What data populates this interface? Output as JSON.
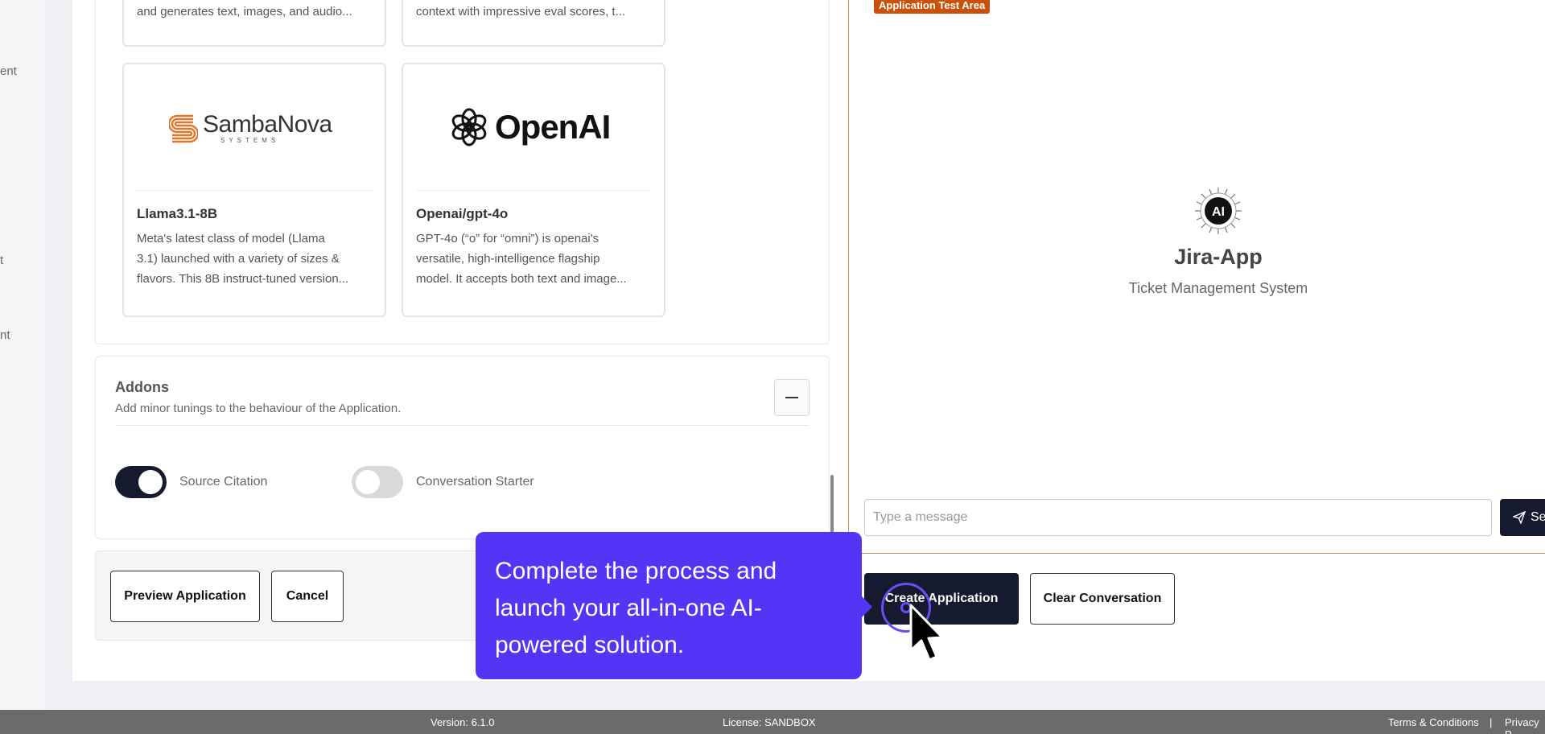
{
  "left_nav": {
    "fragments": [
      "ent",
      "t",
      "nt"
    ]
  },
  "models": {
    "top_cards": [
      {
        "desc": "and generates text, images, and audio..."
      },
      {
        "desc": "context with impressive eval scores, t..."
      }
    ],
    "cards": [
      {
        "brand_main": "SambaNova",
        "brand_sub": "SYSTEMS",
        "name": "Llama3.1-8B",
        "desc": [
          "Meta's latest class of model (Llama",
          "3.1) launched with a variety of sizes &",
          "flavors. This 8B instruct-tuned version..."
        ]
      },
      {
        "brand_main": "OpenAI",
        "name": "Openai/gpt-4o",
        "desc": [
          "GPT-4o (“o” for “omni”) is openai's",
          "versatile, high-intelligence flagship",
          "model. It accepts both text and image..."
        ]
      }
    ]
  },
  "addons": {
    "title": "Addons",
    "subtitle": "Add minor tunings to the behaviour of the Application.",
    "toggles": [
      {
        "label": "Source Citation",
        "on": true
      },
      {
        "label": "Conversation Starter",
        "on": false
      }
    ]
  },
  "actions": {
    "preview_label": "Preview Application",
    "cancel_label": "Cancel",
    "create_label": "Create Application",
    "clear_label": "Clear Conversation"
  },
  "test_area": {
    "tag": "Application Test Area",
    "logo_text": "AI",
    "app_title": "Jira-App",
    "app_subtitle": "Ticket Management System",
    "input_placeholder": "Type a message",
    "send_label": "Se"
  },
  "tooltip": {
    "lines": [
      "Complete the process and",
      "launch your all-in-one AI-",
      "powered solution."
    ]
  },
  "status_bar": {
    "version": "Version: 6.1.0",
    "license": "License: SANDBOX",
    "terms": "Terms & Conditions",
    "separator": "|",
    "privacy": "Privacy P"
  },
  "colors": {
    "accent_dark": "#151a2e",
    "tooltip": "#5535f5",
    "tag": "#c8510b",
    "samba_orange": "#e8742a"
  }
}
